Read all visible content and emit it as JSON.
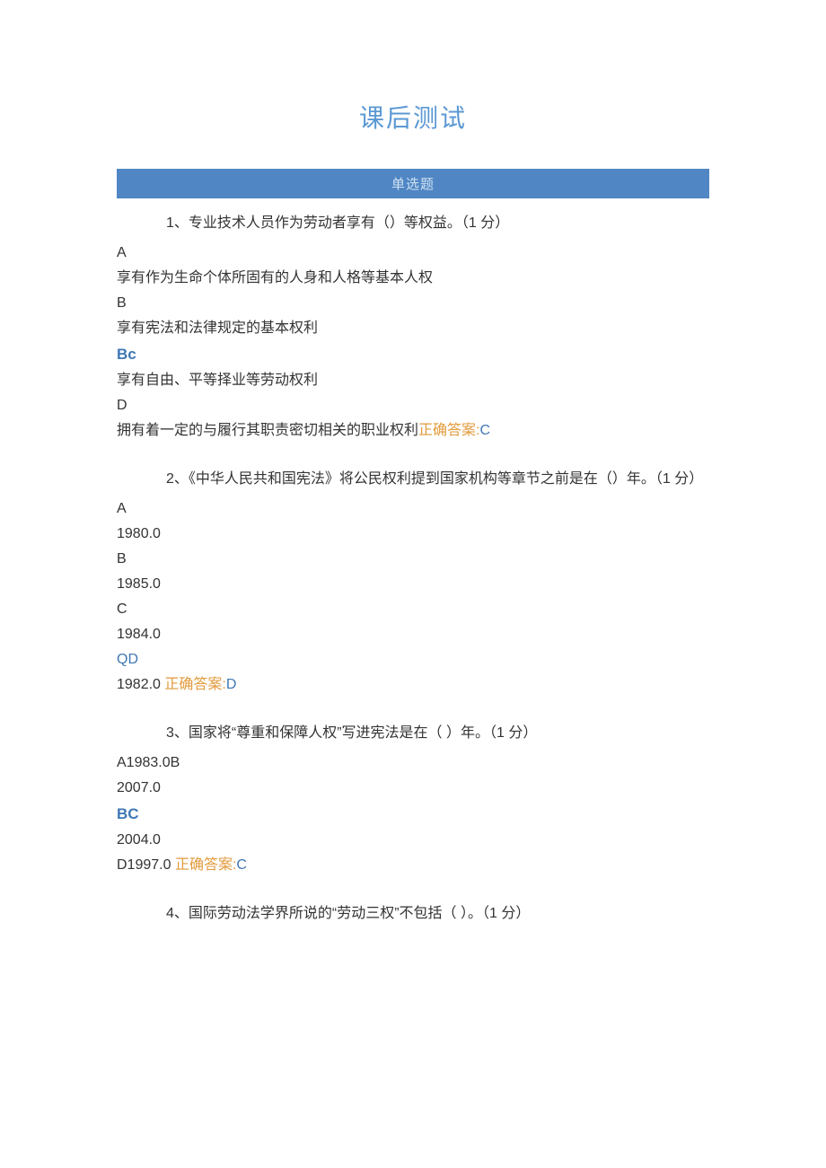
{
  "title": "课后测试",
  "section_header": "单选题",
  "q1": {
    "text": "1、专业技术人员作为劳动者享有（）等权益。（1 分）",
    "A_letter": "A",
    "A_text": "享有作为生命个体所固有的人身和人格等基本人权",
    "B_letter": "B",
    "B_text": "享有宪法和法律规定的基本权利",
    "Bc": "Bc",
    "C_text": "享有自由、平等择业等劳动权利",
    "D_letter": "D",
    "D_text": "拥有着一定的与履行其职责密切相关的职业权利",
    "answer_label": "正确答案:",
    "answer": "C"
  },
  "q2": {
    "text": "2、《中华人民共和国宪法》将公民权利提到国家机构等章节之前是在（）年。（1 分）",
    "A_letter": "A",
    "A_val": "1980.0",
    "B_letter": "B",
    "B_val": "1985.0",
    "C_letter": "C",
    "C_val": "1984.0",
    "QD": "QD",
    "D_val": "1982.0",
    "answer_label": "正确答案:",
    "answer": "D"
  },
  "q3": {
    "text": "3、国家将“尊重和保障人权”写进宪法是在（ ）年。（1 分）",
    "line1": "A1983.0B",
    "line2": "2007.0",
    "BC": "BC",
    "line4": "2004.0",
    "line5_prefix": "D1997.0 ",
    "answer_label": "正确答案:",
    "answer": "C"
  },
  "q4": {
    "text": "4、国际劳动法学界所说的“劳动三权”不包括（ ）。（1 分）"
  }
}
